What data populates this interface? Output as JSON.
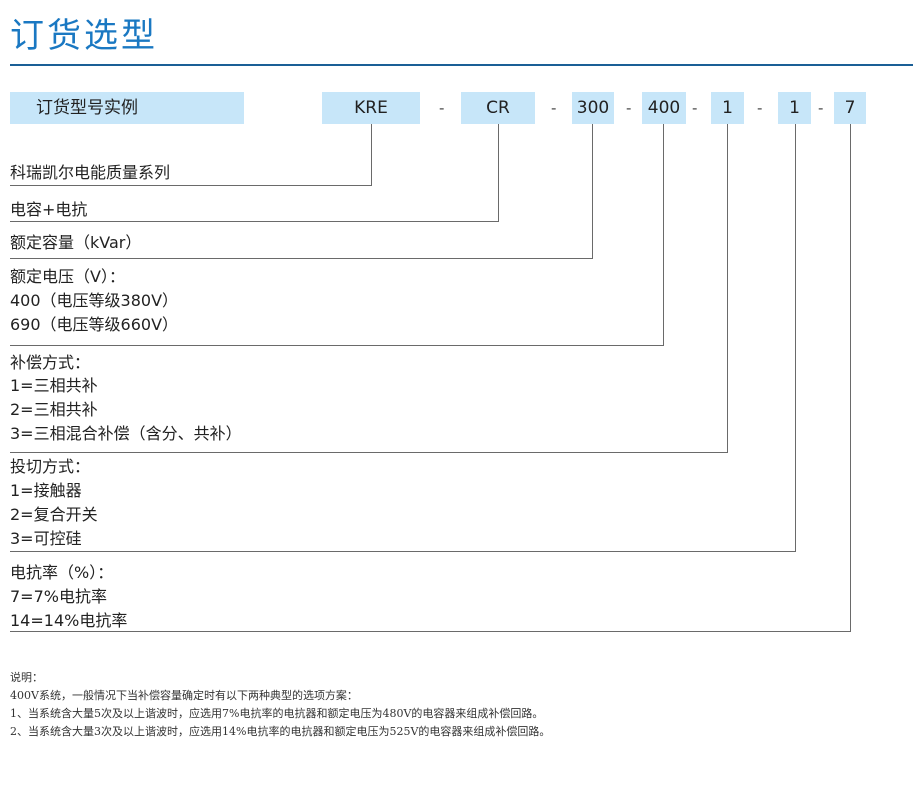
{
  "title": "订货选型",
  "example_label": "订货型号实例",
  "separator": "-",
  "code_parts": [
    "KRE",
    "CR",
    "300",
    "400",
    "1",
    "1",
    "7"
  ],
  "groups": [
    {
      "lines": [
        "科瑞凯尔电能质量系列"
      ]
    },
    {
      "lines": [
        "电容+电抗"
      ]
    },
    {
      "lines": [
        "额定容量（kVar）"
      ]
    },
    {
      "lines": [
        "额定电压（V）：",
        "400（电压等级380V）",
        "690（电压等级660V）"
      ]
    },
    {
      "lines": [
        "补偿方式：",
        "1=三相共补",
        "2=三相共补",
        "3=三相混合补偿（含分、共补）"
      ]
    },
    {
      "lines": [
        "投切方式：",
        "1=接触器",
        "2=复合开关",
        "3=可控硅"
      ]
    },
    {
      "lines": [
        "电抗率（%）：",
        "7=7%电抗率",
        "14=14%电抗率"
      ]
    }
  ],
  "notes": {
    "heading": "说明：",
    "lines": [
      "400V系统，一般情况下当补偿容量确定时有以下两种典型的选项方案：",
      "1、当系统含大量5次及以上谐波时，应选用7%电抗率的电抗器和额定电压为480V的电容器来组成补偿回路。",
      "2、当系统含大量3次及以上谐波时，应选用14%电抗率的电抗器和额定电压为525V的电容器来组成补偿回路。"
    ]
  },
  "colors": {
    "title": "#1a78c2",
    "rule": "#1a5f96",
    "box_fill": "#c7e6f9",
    "line": "#6a6a6a"
  }
}
